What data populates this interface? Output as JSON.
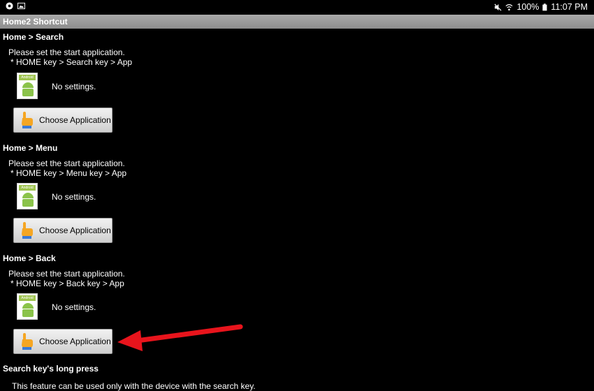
{
  "status_bar": {
    "battery": "100%",
    "time": "11:07 PM"
  },
  "app": {
    "title": "Home2 Shortcut"
  },
  "sections": [
    {
      "header": "Home > Search",
      "desc_line1": "Please set the start application.",
      "desc_line2": "* HOME key > Search key > App",
      "icon_badge": "Android",
      "status": "No settings.",
      "button_label": "Choose Application"
    },
    {
      "header": "Home > Menu",
      "desc_line1": "Please set the start application.",
      "desc_line2": "* HOME key > Menu key > App",
      "icon_badge": "Android",
      "status": "No settings.",
      "button_label": "Choose Application"
    },
    {
      "header": "Home > Back",
      "desc_line1": "Please set the start application.",
      "desc_line2": "* HOME key > Back key > App",
      "icon_badge": "Android",
      "status": "No settings.",
      "button_label": "Choose Application"
    }
  ],
  "long_press": {
    "header": "Search key's long press",
    "desc": "This feature can be used only with the device with the search key."
  },
  "annotation": {
    "color": "#e8141c",
    "icon": "red-arrow-icon"
  }
}
